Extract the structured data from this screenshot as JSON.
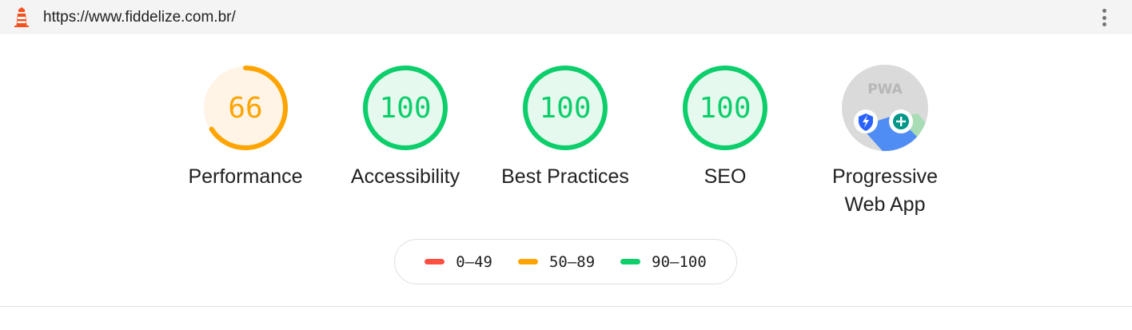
{
  "topbar": {
    "url": "https://www.fiddelize.com.br/",
    "logo_icon": "lighthouse-icon",
    "menu_icon": "more-vertical-icon"
  },
  "gauges": [
    {
      "score": "66",
      "value": 66,
      "label": "Performance",
      "color": "#ffa400",
      "bg": "#fff4e6"
    },
    {
      "score": "100",
      "value": 100,
      "label": "Accessibility",
      "color": "#0cce6b",
      "bg": "#e6f9ee"
    },
    {
      "score": "100",
      "value": 100,
      "label": "Best Practices",
      "color": "#0cce6b",
      "bg": "#e6f9ee"
    },
    {
      "score": "100",
      "value": 100,
      "label": "SEO",
      "color": "#0cce6b",
      "bg": "#e6f9ee"
    }
  ],
  "pwa": {
    "badge_text": "PWA",
    "label_line1": "Progressive",
    "label_line2": "Web App",
    "icons": [
      "fast-reliable-icon",
      "installable-icon"
    ]
  },
  "legend": [
    {
      "range": "0–49",
      "color": "#ff4e42"
    },
    {
      "range": "50–89",
      "color": "#ffa400"
    },
    {
      "range": "90–100",
      "color": "#0cce6b"
    }
  ]
}
